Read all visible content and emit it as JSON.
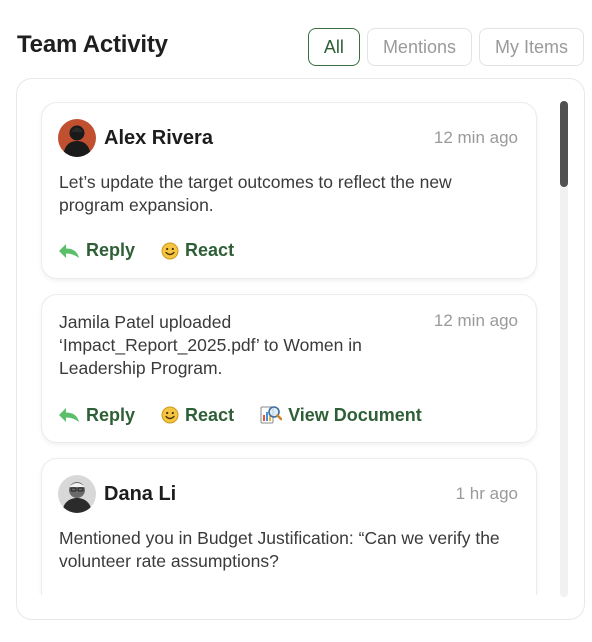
{
  "header": {
    "title": "Team Activity"
  },
  "filters": [
    {
      "label": "All",
      "active": true
    },
    {
      "label": "Mentions",
      "active": false
    },
    {
      "label": "My Items",
      "active": false
    }
  ],
  "activities": [
    {
      "author": "Alex Rivera",
      "time": "12 min ago",
      "text": "Let’s update the target outcomes to reflect the new program expansion.",
      "actions": {
        "reply": "Reply",
        "react": "React"
      }
    },
    {
      "time": "12 min ago",
      "text": "Jamila Patel uploaded ‘Impact_Report_2025.pdf’ to Women in Leadership Program.",
      "actions": {
        "reply": "Reply",
        "react": "React",
        "view": "View Document"
      }
    },
    {
      "author": "Dana Li",
      "time": "1 hr ago",
      "text": "Mentioned you in Budget Justification: “Can we verify the volunteer rate assumptions?"
    }
  ],
  "colors": {
    "accent": "#2f5f36",
    "muted": "#9a9a9a",
    "border": "#e8e8e8"
  }
}
